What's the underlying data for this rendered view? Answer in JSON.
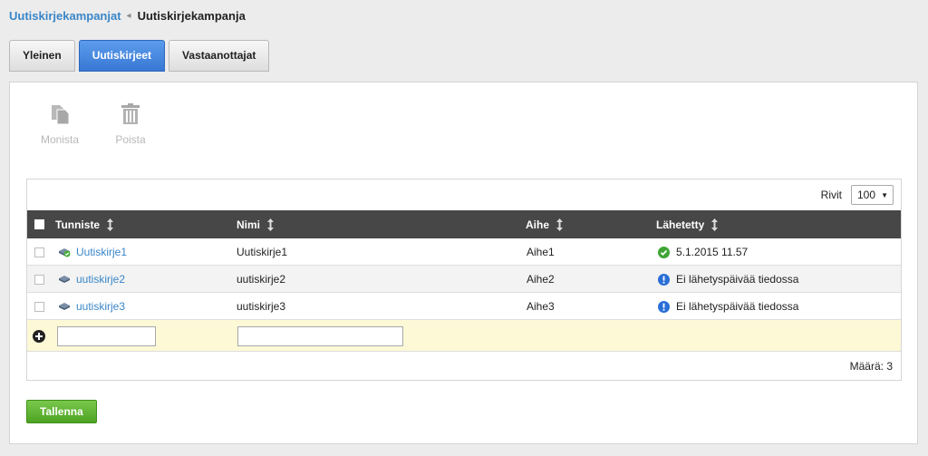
{
  "breadcrumb": {
    "parent": "Uutiskirjekampanjat",
    "current": "Uutiskirjekampanja"
  },
  "tabs": [
    {
      "label": "Yleinen",
      "active": false
    },
    {
      "label": "Uutiskirjeet",
      "active": true
    },
    {
      "label": "Vastaanottajat",
      "active": false
    }
  ],
  "toolbar": {
    "copy_label": "Monista",
    "delete_label": "Poista"
  },
  "grid": {
    "rows_label": "Rivit",
    "rows_value": "100",
    "columns": {
      "id": "Tunniste",
      "name": "Nimi",
      "subject": "Aihe",
      "sent": "Lähetetty"
    },
    "rows": [
      {
        "id": "Uutiskirje1",
        "name": "Uutiskirje1",
        "subject": "Aihe1",
        "sent": "5.1.2015 11.57",
        "status": "sent"
      },
      {
        "id": "uutiskirje2",
        "name": "uutiskirje2",
        "subject": "Aihe2",
        "sent": "Ei lähetyspäivää tiedossa",
        "status": "info"
      },
      {
        "id": "uutiskirje3",
        "name": "uutiskirje3",
        "subject": "Aihe3",
        "sent": "Ei lähetyspäivää tiedossa",
        "status": "info"
      }
    ],
    "new_row": {
      "id_value": "",
      "name_value": ""
    },
    "count_text": "Määrä: 3"
  },
  "save_label": "Tallenna",
  "colors": {
    "link": "#3a86c8",
    "active_tab": "#3a78d4",
    "header": "#474747",
    "save": "#5cb030",
    "new_row": "#fdf8d6"
  }
}
